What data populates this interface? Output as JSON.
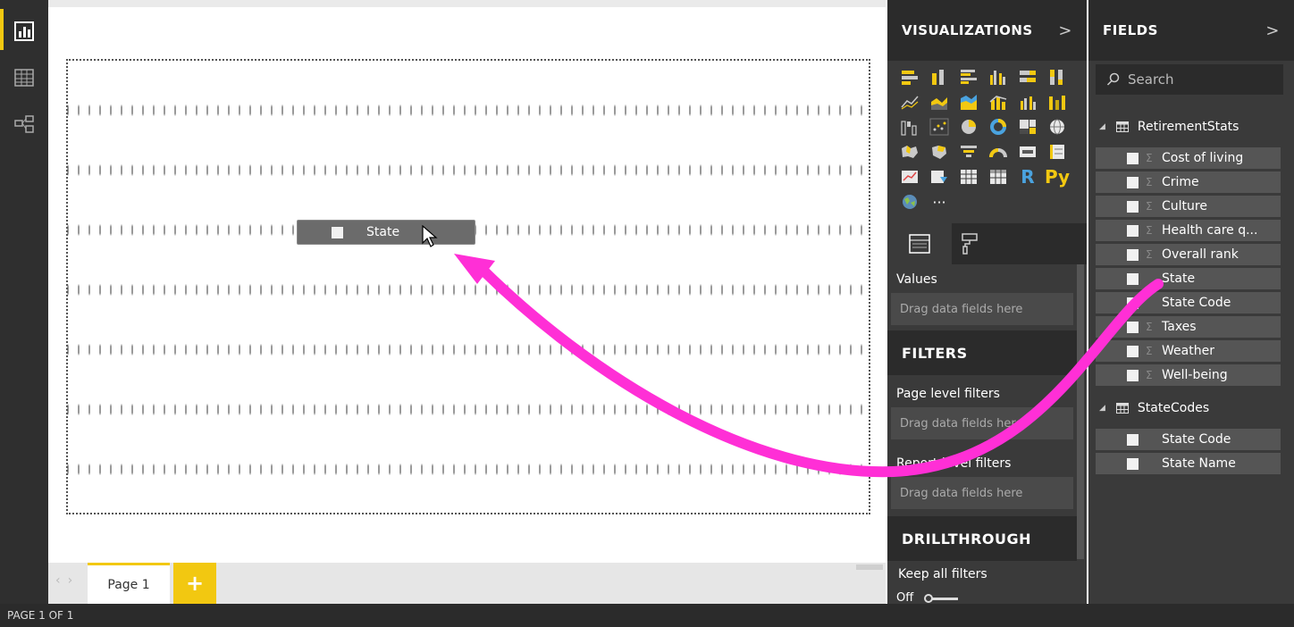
{
  "status": {
    "page_indicator": "PAGE 1 OF 1"
  },
  "canvas": {
    "drag_chip_label": "State"
  },
  "pages": {
    "tabs": [
      "Page 1"
    ],
    "add_label": "+"
  },
  "visualizations": {
    "title": "VISUALIZATIONS",
    "expand_glyph": ">",
    "r_label": "R",
    "py_label": "Py",
    "more_label": "···",
    "values_label": "Values",
    "values_placeholder": "Drag data fields here",
    "filters_title": "FILTERS",
    "page_filters_label": "Page level filters",
    "page_filters_placeholder": "Drag data fields here",
    "report_filters_label": "Report level filters",
    "report_filters_placeholder": "Drag data fields here",
    "drillthrough_title": "DRILLTHROUGH",
    "keep_filters_label": "Keep all filters",
    "toggle_state": "Off"
  },
  "fields": {
    "title": "FIELDS",
    "expand_glyph": ">",
    "search_placeholder": "Search",
    "tables": [
      {
        "name": "RetirementStats",
        "fields": [
          {
            "name": "Cost of living",
            "sigma": true
          },
          {
            "name": "Crime",
            "sigma": true
          },
          {
            "name": "Culture",
            "sigma": true
          },
          {
            "name": "Health care q...",
            "sigma": true
          },
          {
            "name": "Overall rank",
            "sigma": true
          },
          {
            "name": "State",
            "sigma": false
          },
          {
            "name": "State Code",
            "sigma": false
          },
          {
            "name": "Taxes",
            "sigma": true
          },
          {
            "name": "Weather",
            "sigma": true
          },
          {
            "name": "Well-being",
            "sigma": true
          }
        ]
      },
      {
        "name": "StateCodes",
        "fields": [
          {
            "name": "State Code",
            "sigma": false
          },
          {
            "name": "State Name",
            "sigma": false
          }
        ]
      }
    ]
  },
  "colors": {
    "accent": "#f2c811",
    "annotation_arrow": "#ff2fd6",
    "pane_dark": "#2b2b2b",
    "pane": "#3a3a3a"
  },
  "icons": {
    "sigma": "Σ"
  }
}
